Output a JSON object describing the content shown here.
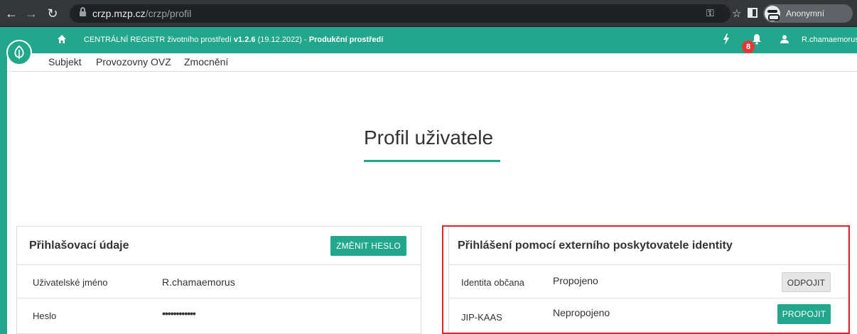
{
  "browser": {
    "url_host": "crzp.mzp.cz",
    "url_path": "/crzp/profil",
    "profile_label": "Anonymní"
  },
  "app": {
    "title_prefix": "CENTRÁLNÍ REGISTR životního prostředí",
    "version": "v1.2.6",
    "version_date": "(19.12.2022) -",
    "environment": "Produkční prostředí",
    "notification_count": "8",
    "username": "R.chamaemorus",
    "accent_color": "#22a68c"
  },
  "subnav": {
    "items": [
      "Subjekt",
      "Provozovny OVZ",
      "Zmocnění"
    ]
  },
  "page": {
    "title": "Profil uživatele"
  },
  "login_card": {
    "title": "Přihlašovací údaje",
    "change_password_button": "ZMĚNIT HESLO",
    "rows": [
      {
        "label": "Uživatelské jméno",
        "value": "R.chamaemorus"
      },
      {
        "label": "Heslo",
        "value": "••••••••••••"
      }
    ]
  },
  "identity_card": {
    "title": "Přihlášení pomocí externího poskytovatele identity",
    "rows": [
      {
        "label": "Identita občana",
        "status": "Propojeno",
        "action": "ODPOJIT"
      },
      {
        "label": "JIP-KAAS",
        "status": "Nepropojeno",
        "action": "PROPOJIT"
      }
    ]
  }
}
